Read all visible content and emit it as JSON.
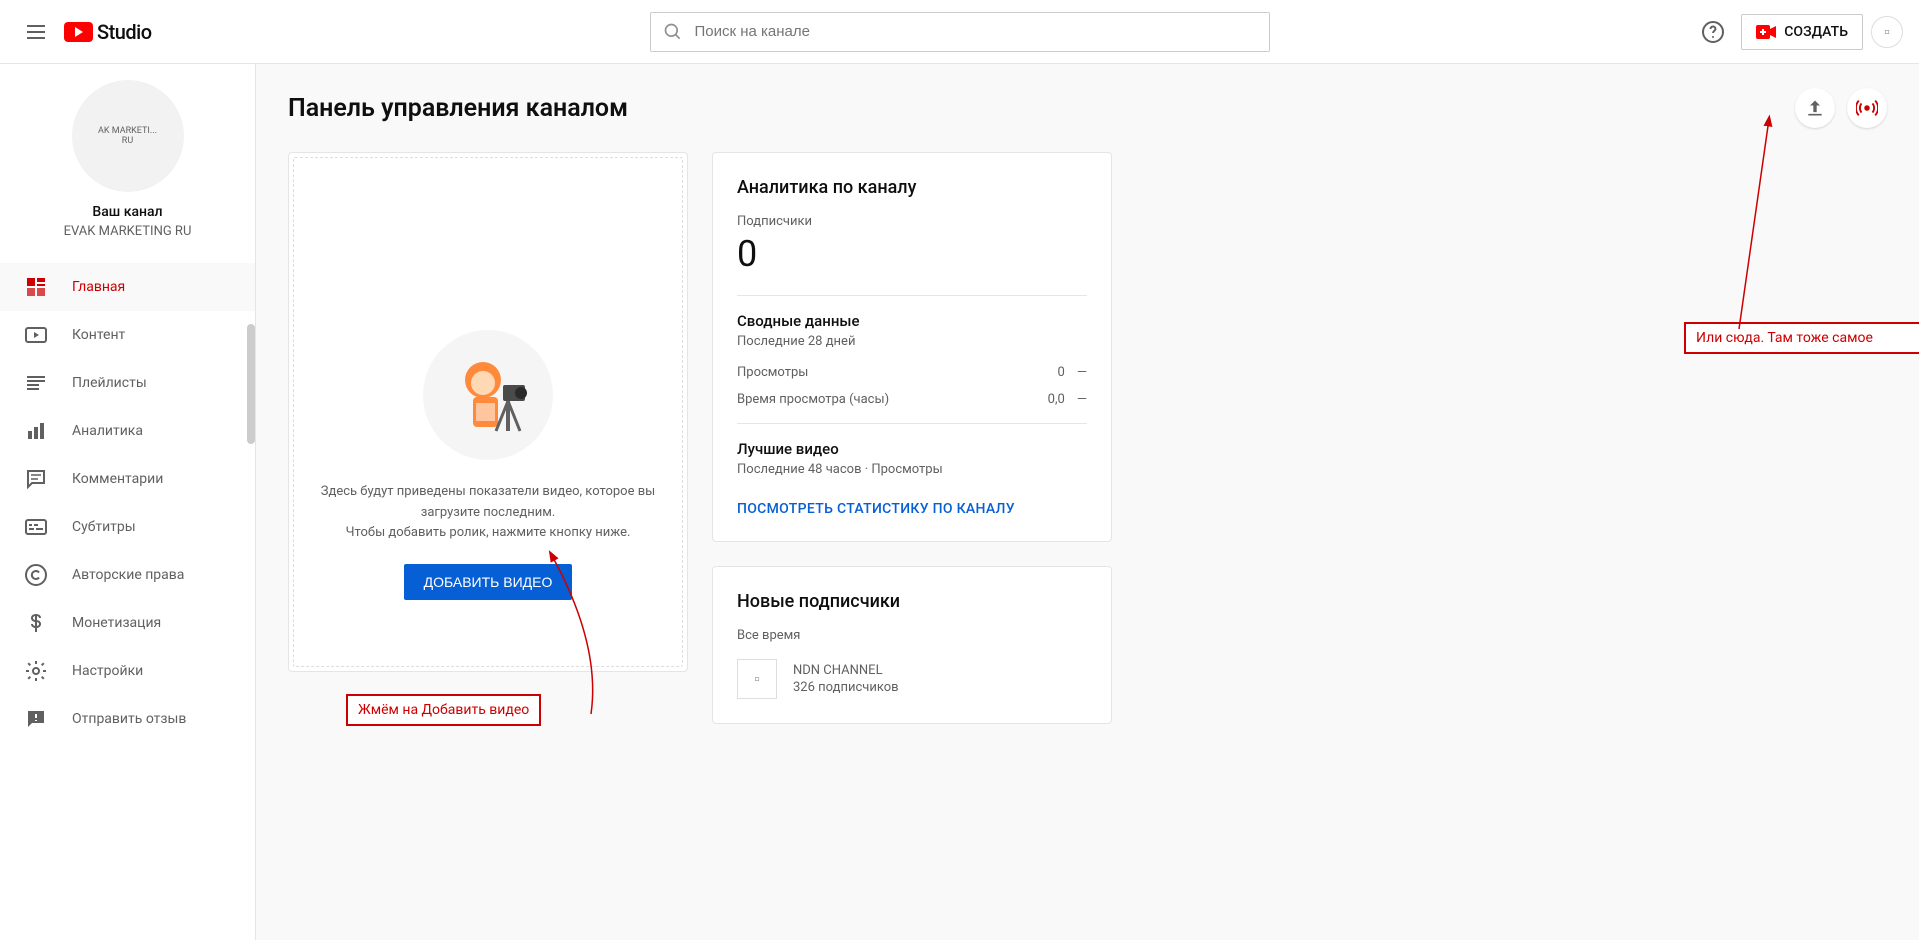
{
  "header": {
    "logo_text": "Studio",
    "search_placeholder": "Поиск на канале",
    "create_label": "СОЗДАТЬ"
  },
  "sidebar": {
    "avatar_text": "AK MARKETI...\nRU",
    "your_channel": "Ваш канал",
    "channel_name": "EVAK MARKETING RU",
    "items": [
      {
        "label": "Главная",
        "icon": "dashboard"
      },
      {
        "label": "Контент",
        "icon": "video"
      },
      {
        "label": "Плейлисты",
        "icon": "playlist"
      },
      {
        "label": "Аналитика",
        "icon": "analytics"
      },
      {
        "label": "Комментарии",
        "icon": "comments"
      },
      {
        "label": "Субтитры",
        "icon": "subtitles"
      },
      {
        "label": "Авторские права",
        "icon": "copyright"
      },
      {
        "label": "Монетизация",
        "icon": "dollar"
      },
      {
        "label": "Настройки",
        "icon": "settings"
      },
      {
        "label": "Отправить отзыв",
        "icon": "feedback"
      }
    ]
  },
  "page": {
    "title": "Панель управления каналом"
  },
  "upload_card": {
    "text1": "Здесь будут приведены показатели видео, которое вы загрузите последним.",
    "text2": "Чтобы добавить ролик, нажмите кнопку ниже.",
    "button": "ДОБАВИТЬ ВИДЕО"
  },
  "analytics_card": {
    "title": "Аналитика по каналу",
    "subscribers_label": "Подписчики",
    "subscribers_count": "0",
    "summary_title": "Сводные данные",
    "summary_period": "Последние 28 дней",
    "views_label": "Просмотры",
    "views_value": "0",
    "watch_label": "Время просмотра (часы)",
    "watch_value": "0,0",
    "top_title": "Лучшие видео",
    "top_period": "Последние 48 часов · Просмотры",
    "link": "ПОСМОТРЕТЬ СТАТИСТИКУ ПО КАНАЛУ"
  },
  "subs_card": {
    "title": "Новые подписчики",
    "period": "Все время",
    "item_name": "NDN CHANNEL",
    "item_count": "326 подписчиков"
  },
  "annotations": {
    "left": "Жмём на Добавить видео",
    "right": "Или сюда. Там тоже самое"
  }
}
